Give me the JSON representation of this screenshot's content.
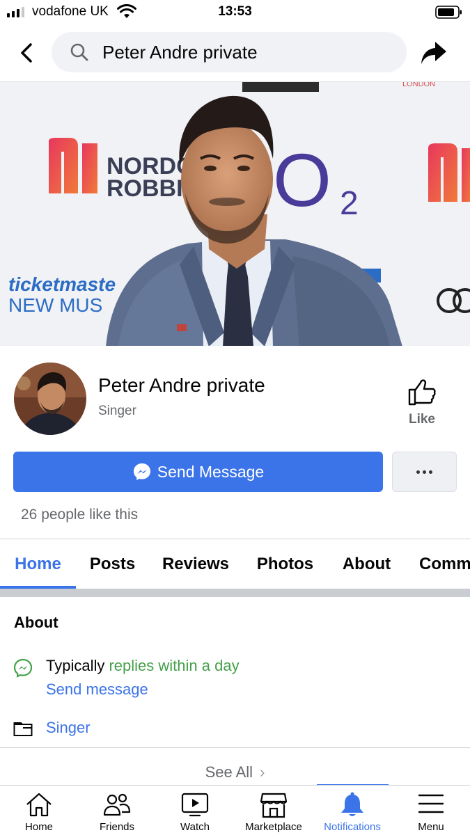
{
  "status_bar": {
    "carrier": "vodafone UK",
    "time": "13:53"
  },
  "header": {
    "search_text": "Peter Andre private"
  },
  "cover": {
    "backdrop_logos": {
      "nordoff_line1": "NORDO",
      "nordoff_line2": "ROBBIN",
      "o2": "O",
      "o2_sub": "2",
      "ticketmaster": "ticketmaste",
      "new_music": "NEW MUS",
      "london": "LONDON"
    }
  },
  "profile": {
    "name": "Peter Andre private",
    "category": "Singer",
    "like_label": "Like",
    "send_message_label": "Send Message",
    "likes_text": "26 people like this"
  },
  "tabs": [
    {
      "label": "Home",
      "active": true
    },
    {
      "label": "Posts"
    },
    {
      "label": "Reviews"
    },
    {
      "label": "Photos"
    },
    {
      "label": "About"
    },
    {
      "label": "Comm"
    }
  ],
  "about": {
    "title": "About",
    "typically": "Typically",
    "response_time": "replies within a day",
    "send_message_link": "Send message",
    "category_link": "Singer",
    "see_all": "See All"
  },
  "bottom_nav": [
    {
      "label": "Home",
      "icon": "home-icon"
    },
    {
      "label": "Friends",
      "icon": "friends-icon"
    },
    {
      "label": "Watch",
      "icon": "watch-icon"
    },
    {
      "label": "Marketplace",
      "icon": "marketplace-icon"
    },
    {
      "label": "Notifications",
      "icon": "bell-icon",
      "active": true
    },
    {
      "label": "Menu",
      "icon": "menu-icon"
    }
  ],
  "colors": {
    "accent": "#3b74e8",
    "green": "#45a049",
    "muted": "#65676b"
  }
}
